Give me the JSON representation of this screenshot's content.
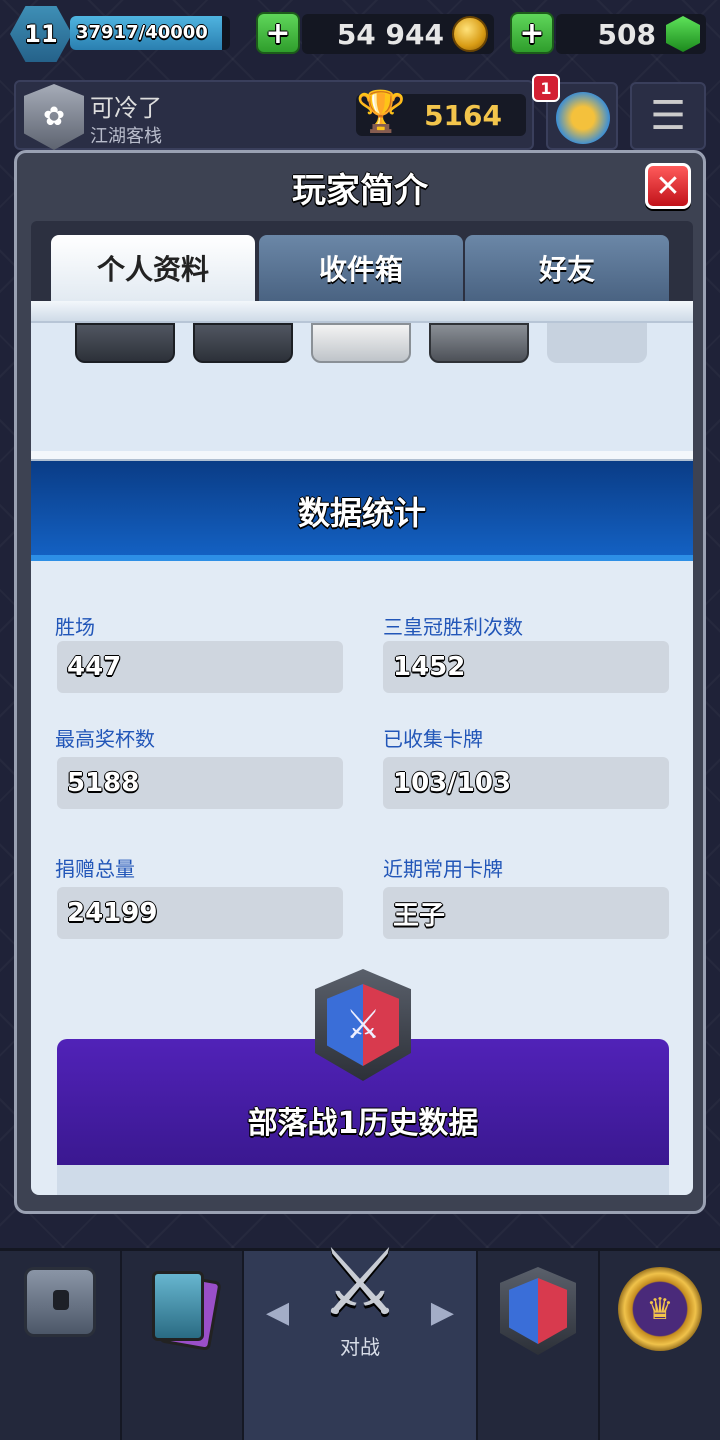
{
  "topbar": {
    "level": "11",
    "xp": "37917/40000",
    "xp_progress": 0.948,
    "plus_label": "+",
    "gold": "54 944",
    "gems": "508"
  },
  "player": {
    "name": "可冷了",
    "clan": "江湖客栈",
    "trophies": "5164",
    "notification_count": "1"
  },
  "modal": {
    "title": "玩家简介",
    "close_label": "✕",
    "tabs": [
      {
        "label": "个人资料",
        "active": true
      },
      {
        "label": "收件箱",
        "active": false
      },
      {
        "label": "好友",
        "active": false
      }
    ],
    "stats_header": "数据统计",
    "stats": [
      {
        "label": "胜场",
        "value": "447"
      },
      {
        "label": "三皇冠胜利次数",
        "value": "1452"
      },
      {
        "label": "最高奖杯数",
        "value": "5188"
      },
      {
        "label": "已收集卡牌",
        "value": "103/103"
      },
      {
        "label": "捐赠总量",
        "value": "24199"
      },
      {
        "label": "近期常用卡牌",
        "value": "王子"
      }
    ],
    "clan_war_title": "部落战1历史数据"
  },
  "nav": {
    "battle_label": "对战",
    "active": "battle"
  },
  "icons": {
    "level": "level-badge-icon",
    "gold": "gold-coin-icon",
    "gem": "gem-icon",
    "trophy": "trophy-icon",
    "menu": "hamburger-menu-icon",
    "chest": "chest-icon",
    "cards": "cards-icon",
    "battle": "crossed-swords-icon",
    "clan_war": "clan-war-icon",
    "crown": "crown-icon"
  }
}
